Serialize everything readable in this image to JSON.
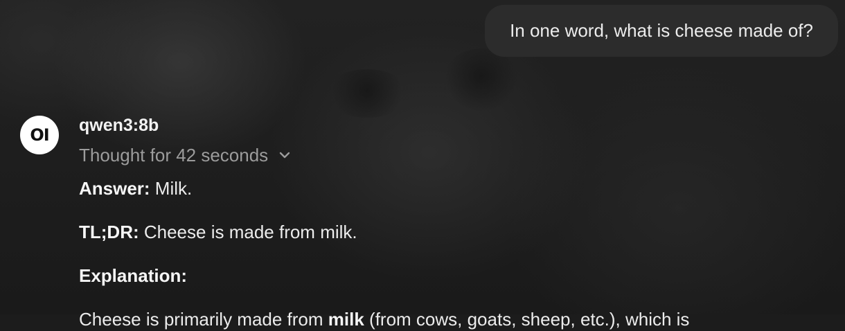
{
  "user_message": "In one word, what is cheese made of?",
  "assistant": {
    "avatar_text": "OI",
    "model_name": "qwen3:8b",
    "thought_label": "Thought for 42 seconds",
    "thought_icon": "chevron-down-icon",
    "answer_label": "Answer:",
    "answer_text": " Milk.",
    "tldr_label": "TL;DR:",
    "tldr_text": " Cheese is made from milk.",
    "explanation_heading": "Explanation:",
    "explanation_prefix": "Cheese is primarily made from ",
    "explanation_bold": "milk",
    "explanation_suffix": " (from cows, goats, sheep, etc.), which is"
  }
}
